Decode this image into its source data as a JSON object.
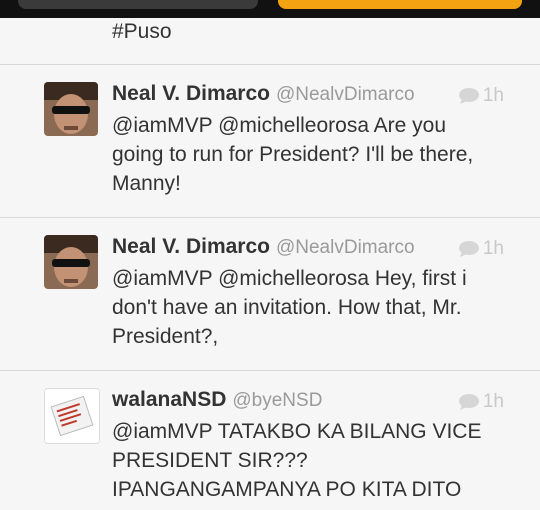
{
  "partial_tweet": {
    "text": "#Puso"
  },
  "tweets": [
    {
      "name": "Neal V. Dimarco",
      "handle": "@NealvDimarco",
      "time": "1h",
      "lines": [
        "@iamMVP @michelleorosa Are you",
        "going to run for President? I'll be there,",
        "Manny!"
      ]
    },
    {
      "name": "Neal V. Dimarco",
      "handle": "@NealvDimarco",
      "time": "1h",
      "lines": [
        "@iamMVP @michelleorosa Hey, first i",
        "don't have an invitation. How that, Mr.",
        "President?,"
      ]
    },
    {
      "name": "walanaNSD",
      "handle": "@byeNSD",
      "time": "1h",
      "lines": [
        "@iamMVP TATAKBO KA BILANG VICE",
        "PRESIDENT SIR???",
        "IPANGANGAMPANYA PO KITA DITO"
      ]
    }
  ],
  "colors": {
    "accent": "#f3a311",
    "topbar": "#111111",
    "divider": "#d9d9d9"
  },
  "icons": {
    "reply": "speech-bubble-icon"
  }
}
